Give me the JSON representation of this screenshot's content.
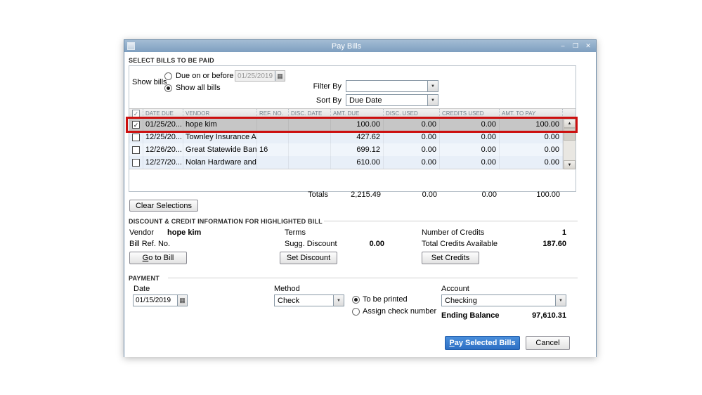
{
  "window": {
    "title": "Pay Bills"
  },
  "icons": {
    "minimize_glyph": "–",
    "maximize_glyph": "❒",
    "close_glyph": "✕",
    "checkmark": "✓",
    "calendar": "▦",
    "dropdown_arrow": "▼",
    "scroll_up": "▲",
    "scroll_down": "▼"
  },
  "colors": {
    "titlebar_blue": "#8fadc9",
    "primary_button_blue": "#2d6fc4",
    "highlight_red": "#cc0f0f",
    "selected_row_gray": "#c6c6c6",
    "row_alt_blue": "#e8eff8"
  },
  "select_bills": {
    "section_label": "SELECT BILLS TO BE PAID",
    "show_bills_label": "Show bills",
    "due_on_or_before_label": "Due on or before",
    "due_date_value": "01/25/2019",
    "show_all_bills_label": "Show all bills",
    "filter_by_label": "Filter By",
    "filter_by_value": "",
    "sort_by_label": "Sort By",
    "sort_by_value": "Due Date",
    "clear_selections_label": "Clear Selections"
  },
  "table": {
    "columns": [
      "DATE DUE",
      "VENDOR",
      "REF. NO.",
      "DISC. DATE",
      "AMT. DUE",
      "DISC. USED",
      "CREDITS USED",
      "AMT. TO PAY"
    ],
    "rows": [
      {
        "checked": true,
        "date_due": "01/25/20...",
        "vendor": "hope kim",
        "ref_no": "",
        "disc_date": "",
        "amt_due": "100.00",
        "disc_used": "0.00",
        "credits_used": "0.00",
        "amt_to_pay": "100.00"
      },
      {
        "checked": false,
        "date_due": "12/25/20...",
        "vendor": "Townley Insurance A...",
        "ref_no": "",
        "disc_date": "",
        "amt_due": "427.62",
        "disc_used": "0.00",
        "credits_used": "0.00",
        "amt_to_pay": "0.00"
      },
      {
        "checked": false,
        "date_due": "12/26/20...",
        "vendor": "Great Statewide Bank",
        "ref_no": "16",
        "disc_date": "",
        "amt_due": "699.12",
        "disc_used": "0.00",
        "credits_used": "0.00",
        "amt_to_pay": "0.00"
      },
      {
        "checked": false,
        "date_due": "12/27/20...",
        "vendor": "Nolan Hardware and ...",
        "ref_no": "",
        "disc_date": "",
        "amt_due": "610.00",
        "disc_used": "0.00",
        "credits_used": "0.00",
        "amt_to_pay": "0.00"
      }
    ],
    "totals_label": "Totals",
    "totals": {
      "amt_due": "2,215.49",
      "disc_used": "0.00",
      "credits_used": "0.00",
      "amt_to_pay": "100.00"
    }
  },
  "discount_credit": {
    "section_label": "DISCOUNT & CREDIT INFORMATION FOR HIGHLIGHTED BILL",
    "vendor_label": "Vendor",
    "vendor_value": "hope kim",
    "bill_ref_label": "Bill Ref. No.",
    "bill_ref_value": "",
    "terms_label": "Terms",
    "terms_value": "",
    "sugg_discount_label": "Sugg. Discount",
    "sugg_discount_value": "0.00",
    "number_of_credits_label": "Number of Credits",
    "number_of_credits_value": "1",
    "total_credits_label": "Total Credits Available",
    "total_credits_value": "187.60",
    "go_to_bill_label": "Go to Bill",
    "set_discount_label": "Set Discount",
    "set_credits_label": "Set Credits"
  },
  "payment": {
    "section_label": "PAYMENT",
    "date_label": "Date",
    "date_value": "01/15/2019",
    "method_label": "Method",
    "method_value": "Check",
    "to_be_printed_label": "To be printed",
    "assign_check_number_label": "Assign check number",
    "account_label": "Account",
    "account_value": "Checking",
    "ending_balance_label": "Ending Balance",
    "ending_balance_value": "97,610.31"
  },
  "footer": {
    "pay_selected_bills_label": "Pay Selected Bills",
    "cancel_label": "Cancel"
  }
}
